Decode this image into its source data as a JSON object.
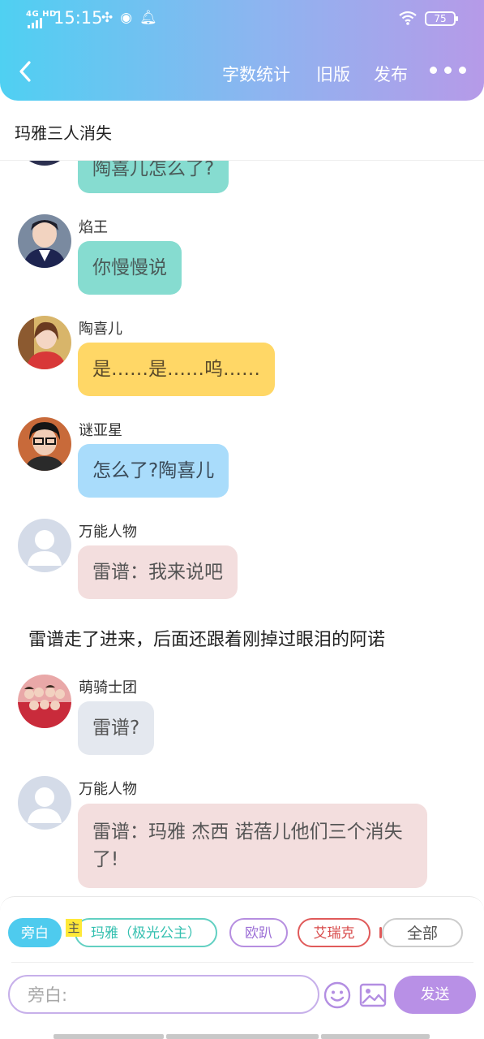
{
  "status_bar": {
    "network": "4G HD",
    "time": "15:15",
    "battery": "75",
    "icons": [
      "fan-icon",
      "speedometer-icon",
      "bell-icon",
      "wifi-icon"
    ]
  },
  "header": {
    "back_icon": "chevron-left-icon",
    "actions": [
      "字数统计",
      "旧版",
      "发布"
    ],
    "more_icon": "more-dots-icon"
  },
  "title": "玛雅三人消失",
  "messages": [
    {
      "type": "dialogue",
      "name": "",
      "avatar": "dark-avatar",
      "text": "陶喜儿怎么了?",
      "bubble_color": "#86dcd0",
      "text_color": "#4a5a58"
    },
    {
      "type": "dialogue",
      "name": "焰王",
      "avatar": "photo-avatar",
      "text": "你慢慢说",
      "bubble_color": "#86dcd0",
      "text_color": "#4a5a58"
    },
    {
      "type": "dialogue",
      "name": "陶喜儿",
      "avatar": "photo-avatar",
      "text": "是……是……呜……",
      "bubble_color": "#ffd766",
      "text_color": "#5a4a2a"
    },
    {
      "type": "dialogue",
      "name": "谜亚星",
      "avatar": "photo-avatar",
      "text": "怎么了?陶喜儿",
      "bubble_color": "#a9dcfb",
      "text_color": "#3a4a58"
    },
    {
      "type": "dialogue",
      "name": "万能人物",
      "avatar": "default-user-avatar",
      "text": "雷谱：我来说吧",
      "bubble_color": "#f3dede",
      "text_color": "#555555"
    },
    {
      "type": "narration",
      "text": "雷谱走了进来，后面还跟着刚掉过眼泪的阿诺"
    },
    {
      "type": "dialogue",
      "name": "萌骑士团",
      "avatar": "group-photo-avatar",
      "text": "雷谱?",
      "bubble_color": "#e4e8ef",
      "text_color": "#555555"
    },
    {
      "type": "dialogue",
      "name": "万能人物",
      "avatar": "default-user-avatar",
      "text": "雷谱：玛雅 杰西 诺蓓儿他们三个消失了!",
      "bubble_color": "#f3dede",
      "text_color": "#555555"
    }
  ],
  "role_chips": {
    "aside": "旁白",
    "host_tag": "主",
    "maya": "玛雅（极光公主）",
    "oubao": "欧趴",
    "ariko": "艾瑞克",
    "all": "全部"
  },
  "input": {
    "placeholder": "旁白:",
    "value": ""
  },
  "send_label": "发送",
  "bottom_icons": [
    "emoji-icon",
    "image-icon"
  ],
  "colors": {
    "header_gradient_start": "#4fd0f2",
    "header_gradient_end": "#b69ae8",
    "send_button": "#b890e6",
    "teal_bubble": "#86dcd0",
    "yellow_bubble": "#ffd766",
    "blue_bubble": "#a9dcfb",
    "pink_bubble": "#f3dede"
  }
}
